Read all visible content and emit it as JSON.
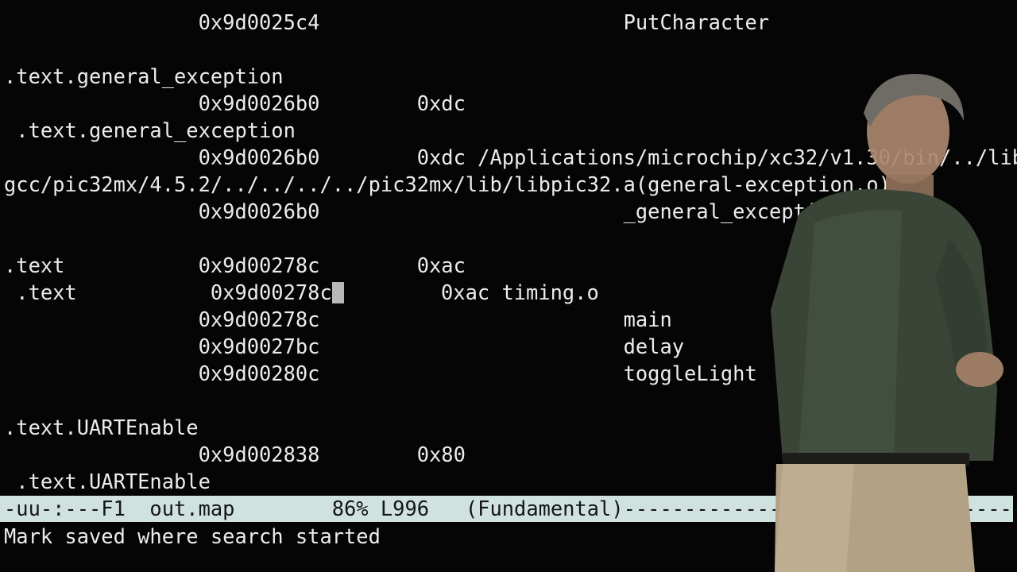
{
  "window": {
    "mode": "emacs",
    "file": "out.map"
  },
  "buffer": {
    "lines": [
      "                0x9d0025c4                         PutCharacter",
      "",
      ".text.general_exception",
      "                0x9d0026b0        0xdc",
      " .text.general_exception",
      "                0x9d0026b0        0xdc /Applications/microchip/xc32/v1.30/bin/../lib/",
      "gcc/pic32mx/4.5.2/../../../../pic32mx/lib/libpic32.a(general-exception.o)",
      "                0x9d0026b0                         _general_exception_context",
      "",
      ".text           0x9d00278c        0xac",
      " .text           0x9d00278c        0xac timing.o",
      "                0x9d00278c                         main",
      "                0x9d0027bc                         delay",
      "                0x9d00280c                         toggleLight",
      "",
      ".text.UARTEnable",
      "                0x9d002838        0x80",
      " .text.UARTEnable"
    ],
    "cursor_line_before": " .text           0x9d00278c",
    "cursor_line_after": "        0xac timing.o"
  },
  "modeline": {
    "text": "-uu-:---F1  out.map        86% L996   (Fundamental)------------------------------------------------"
  },
  "minibuffer": {
    "text": "Mark saved where search started"
  },
  "colors": {
    "background": "#050505",
    "foreground": "#ececec",
    "modeline_bg": "#cfe2e0"
  }
}
